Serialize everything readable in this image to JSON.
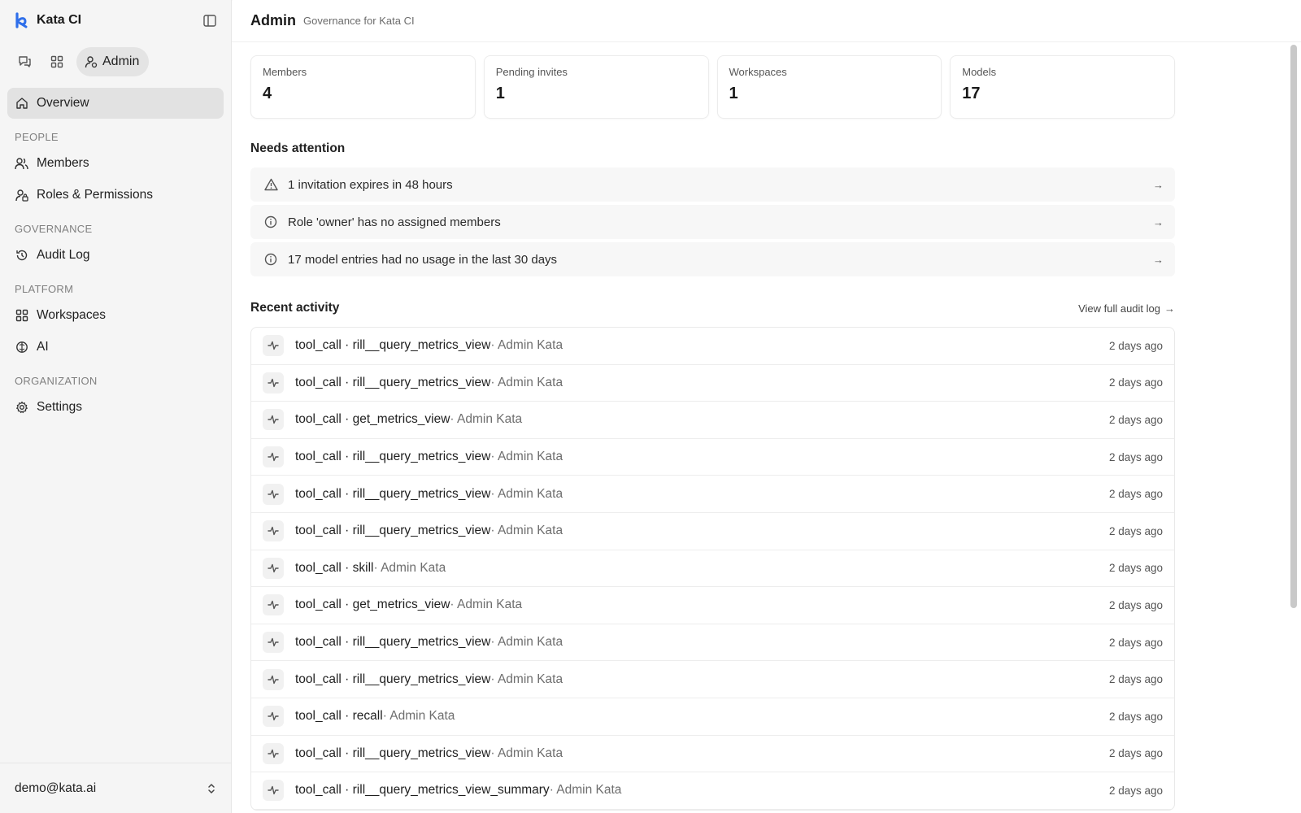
{
  "app": {
    "name": "Kata CI"
  },
  "switcher": {
    "admin_label": "Admin"
  },
  "sidebar": {
    "overview": "Overview",
    "sections": {
      "people": "PEOPLE",
      "governance": "GOVERNANCE",
      "platform": "PLATFORM",
      "organization": "ORGANIZATION"
    },
    "items": {
      "members": "Members",
      "roles": "Roles & Permissions",
      "audit": "Audit Log",
      "workspaces": "Workspaces",
      "ai": "AI",
      "settings": "Settings"
    },
    "user_email": "demo@kata.ai"
  },
  "header": {
    "title": "Admin",
    "subtitle": "Governance for Kata CI"
  },
  "stats": [
    {
      "label": "Members",
      "value": "4"
    },
    {
      "label": "Pending invites",
      "value": "1"
    },
    {
      "label": "Workspaces",
      "value": "1"
    },
    {
      "label": "Models",
      "value": "17"
    }
  ],
  "attention": {
    "title": "Needs attention",
    "items": [
      {
        "icon": "warning-triangle-icon",
        "text": "1 invitation expires in 48 hours"
      },
      {
        "icon": "info-circle-icon",
        "text": "Role 'owner' has no assigned members"
      },
      {
        "icon": "info-circle-icon",
        "text": "17 model entries had no usage in the last 30 days"
      }
    ],
    "arrow": "→"
  },
  "activity": {
    "title": "Recent activity",
    "view_all": "View full audit log",
    "view_all_arrow": "→",
    "rows": [
      {
        "event": "tool_call · rill__query_metrics_view",
        "actor": " · Admin Kata",
        "time": "2 days ago"
      },
      {
        "event": "tool_call · rill__query_metrics_view",
        "actor": " · Admin Kata",
        "time": "2 days ago"
      },
      {
        "event": "tool_call · get_metrics_view",
        "actor": " · Admin Kata",
        "time": "2 days ago"
      },
      {
        "event": "tool_call · rill__query_metrics_view",
        "actor": " · Admin Kata",
        "time": "2 days ago"
      },
      {
        "event": "tool_call · rill__query_metrics_view",
        "actor": " · Admin Kata",
        "time": "2 days ago"
      },
      {
        "event": "tool_call · rill__query_metrics_view",
        "actor": " · Admin Kata",
        "time": "2 days ago"
      },
      {
        "event": "tool_call · skill",
        "actor": " · Admin Kata",
        "time": "2 days ago"
      },
      {
        "event": "tool_call · get_metrics_view",
        "actor": " · Admin Kata",
        "time": "2 days ago"
      },
      {
        "event": "tool_call · rill__query_metrics_view",
        "actor": " · Admin Kata",
        "time": "2 days ago"
      },
      {
        "event": "tool_call · rill__query_metrics_view",
        "actor": " · Admin Kata",
        "time": "2 days ago"
      },
      {
        "event": "tool_call · recall",
        "actor": " · Admin Kata",
        "time": "2 days ago"
      },
      {
        "event": "tool_call · rill__query_metrics_view",
        "actor": " · Admin Kata",
        "time": "2 days ago"
      },
      {
        "event": "tool_call · rill__query_metrics_view_summary",
        "actor": " · Admin Kata",
        "time": "2 days ago"
      }
    ]
  },
  "colors": {
    "accent": "#2f6fea",
    "sidebar_bg": "#f5f5f5",
    "active_bg": "#e2e2e2"
  }
}
